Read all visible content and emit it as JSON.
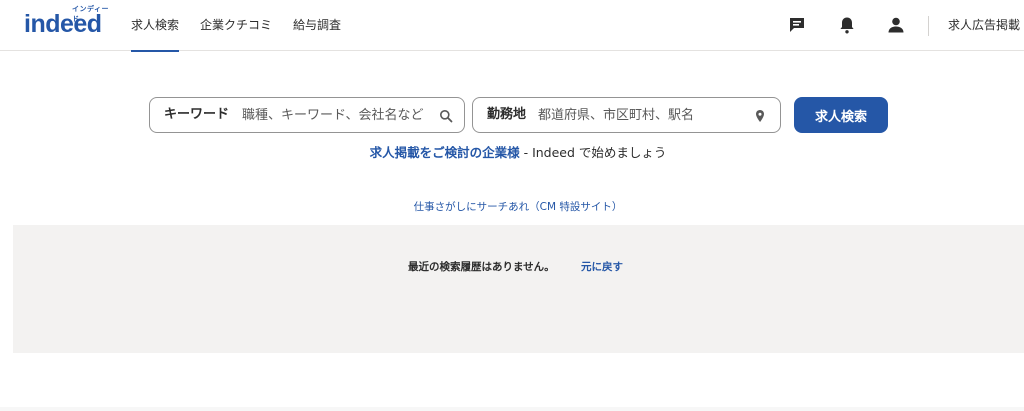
{
  "header": {
    "logo_word": "indeed",
    "logo_kana": "インディード",
    "nav": [
      {
        "label": "求人検索",
        "active": true
      },
      {
        "label": "企業クチコミ",
        "active": false
      },
      {
        "label": "給与調査",
        "active": false
      }
    ],
    "icons": [
      "messages-icon",
      "notifications-icon",
      "account-icon"
    ],
    "employers_label": "求人広告掲載"
  },
  "search": {
    "what_label": "キーワード",
    "what_placeholder": "職種、キーワード、会社名など",
    "where_label": "勤務地",
    "where_placeholder": "都道府県、市区町村、駅名",
    "button_label": "求人検索"
  },
  "post_job": {
    "link_text": "求人掲載をご検討の企業様",
    "rest_text": " - Indeed で始めましょう"
  },
  "cm_link": "仕事さがしにサーチあれ（CM 特設サイト）",
  "history": {
    "message": "最近の検索履歴はありません。",
    "undo_label": "元に戻す"
  },
  "colors": {
    "brand": "#2557a7",
    "panel": "#f3f2f1",
    "text": "#2d2d2d"
  }
}
